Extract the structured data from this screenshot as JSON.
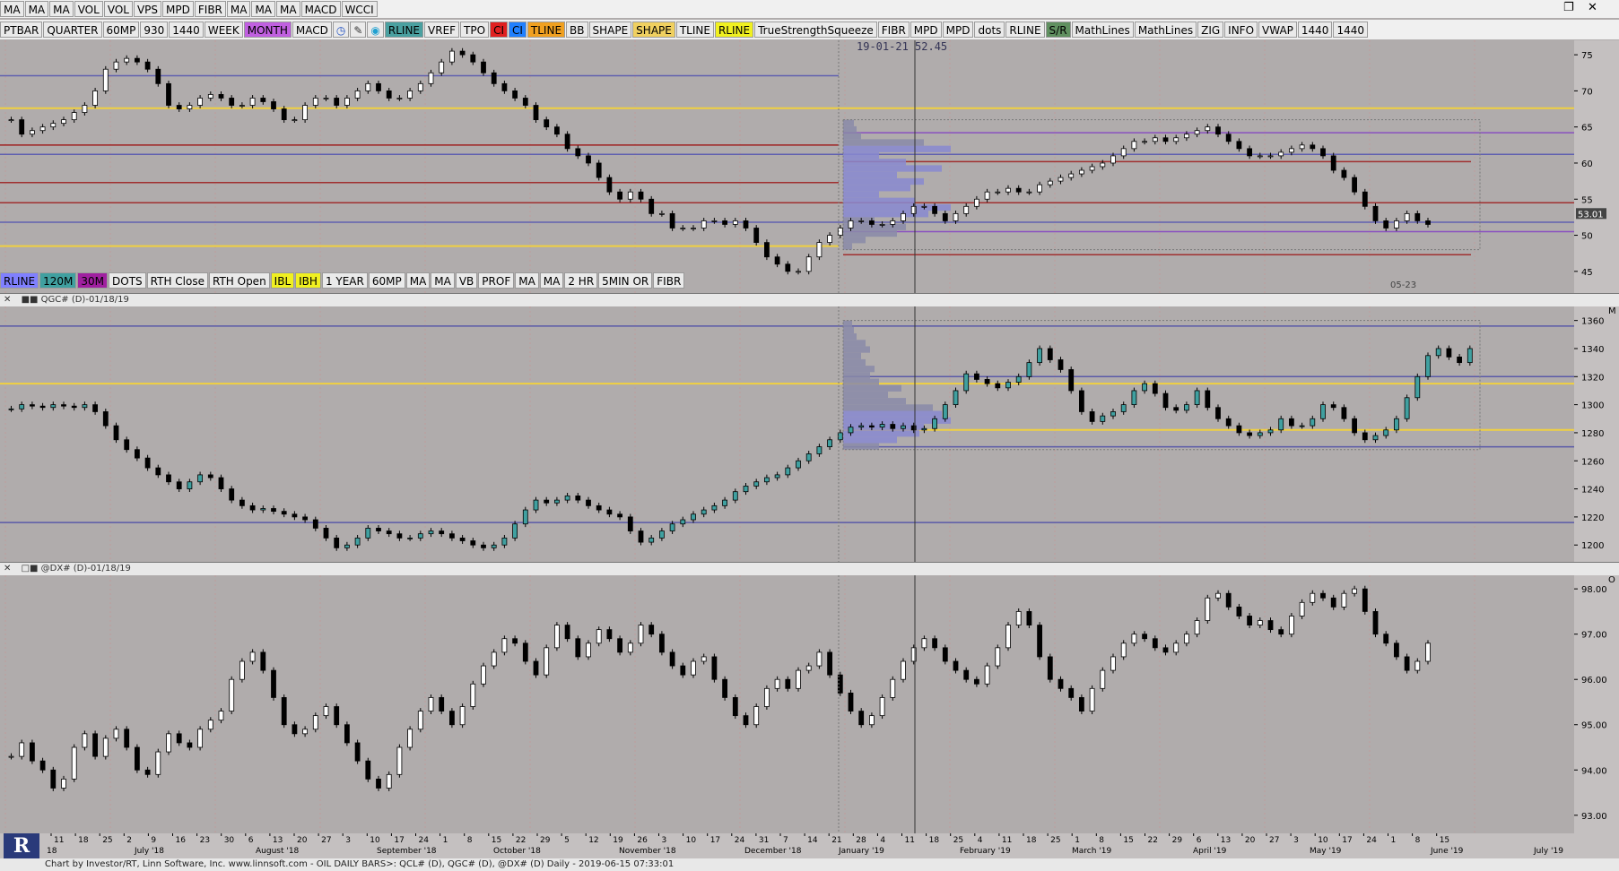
{
  "toolbar_top": [
    "MA",
    "MA",
    "MA",
    "VOL",
    "VOL",
    "VPS",
    "MPD",
    "FIBR",
    "MA",
    "MA",
    "MA",
    "MACD",
    "WCCI"
  ],
  "toolbar_main": [
    {
      "label": "PTBAR",
      "bg": "#eaeaea"
    },
    {
      "label": "QUARTER",
      "bg": "#eaeaea"
    },
    {
      "label": "60MP",
      "bg": "#eaeaea"
    },
    {
      "label": "930",
      "bg": "#eaeaea"
    },
    {
      "label": "1440",
      "bg": "#eaeaea"
    },
    {
      "label": "WEEK",
      "bg": "#eaeaea"
    },
    {
      "label": "MONTH",
      "bg": "#c060e0"
    },
    {
      "label": "MACD",
      "bg": "#eaeaea"
    },
    {
      "label": "clock-icon",
      "bg": "#eaeaea",
      "icon": true
    },
    {
      "label": "pencil-icon",
      "bg": "#eaeaea",
      "icon": true
    },
    {
      "label": "drop-icon",
      "bg": "#eaeaea",
      "icon": true
    },
    {
      "label": "RLINE",
      "bg": "#4aa0a0"
    },
    {
      "label": "VREF",
      "bg": "#eaeaea"
    },
    {
      "label": "TPO",
      "bg": "#eaeaea"
    },
    {
      "label": "CI",
      "bg": "#e02020"
    },
    {
      "label": "CI",
      "bg": "#2080ff"
    },
    {
      "label": "TLINE",
      "bg": "#f0a020"
    },
    {
      "label": "BB",
      "bg": "#eaeaea"
    },
    {
      "label": "SHAPE",
      "bg": "#eaeaea"
    },
    {
      "label": "SHAPE",
      "bg": "#f0d060"
    },
    {
      "label": "TLINE",
      "bg": "#eaeaea"
    },
    {
      "label": "RLINE",
      "bg": "#f0f020"
    },
    {
      "label": "TrueStrengthSqueeze",
      "bg": "#eaeaea"
    },
    {
      "label": "FIBR",
      "bg": "#eaeaea"
    },
    {
      "label": "MPD",
      "bg": "#eaeaea"
    },
    {
      "label": "MPD",
      "bg": "#eaeaea"
    },
    {
      "label": "dots",
      "bg": "#eaeaea"
    },
    {
      "label": "RLINE",
      "bg": "#eaeaea"
    },
    {
      "label": "S/R",
      "bg": "#609060"
    },
    {
      "label": "MathLines",
      "bg": "#eaeaea"
    },
    {
      "label": "MathLines",
      "bg": "#eaeaea"
    },
    {
      "label": "ZIG",
      "bg": "#eaeaea"
    },
    {
      "label": "INFO",
      "bg": "#eaeaea"
    },
    {
      "label": "VWAP",
      "bg": "#eaeaea"
    },
    {
      "label": "1440",
      "bg": "#eaeaea"
    },
    {
      "label": "1440",
      "bg": "#eaeaea"
    }
  ],
  "toolbar_lower": [
    {
      "label": "RLINE",
      "bg": "#8080ff"
    },
    {
      "label": "120M",
      "bg": "#40a0a0"
    },
    {
      "label": "30M",
      "bg": "#a020a0"
    },
    {
      "label": "DOTS",
      "bg": "#eaeaea"
    },
    {
      "label": "RTH Close",
      "bg": "#eaeaea"
    },
    {
      "label": "RTH Open",
      "bg": "#eaeaea"
    },
    {
      "label": "IBL",
      "bg": "#f0f020"
    },
    {
      "label": "IBH",
      "bg": "#f0f020"
    },
    {
      "label": "1 YEAR",
      "bg": "#eaeaea"
    },
    {
      "label": "60MP",
      "bg": "#eaeaea"
    },
    {
      "label": "MA",
      "bg": "#eaeaea"
    },
    {
      "label": "MA",
      "bg": "#eaeaea"
    },
    {
      "label": "VB",
      "bg": "#eaeaea"
    },
    {
      "label": "PROF",
      "bg": "#eaeaea"
    },
    {
      "label": "MA",
      "bg": "#eaeaea"
    },
    {
      "label": "MA",
      "bg": "#eaeaea"
    },
    {
      "label": "2 HR",
      "bg": "#eaeaea"
    },
    {
      "label": "5MIN OR",
      "bg": "#eaeaea"
    },
    {
      "label": "FIBR",
      "bg": "#eaeaea"
    }
  ],
  "cursor_label": "19-01-21  52.45",
  "panel2_title": "QGC# (D)-01/18/19",
  "panel3_title": "@DX# (D)-01/18/19",
  "price_marker": "53.01",
  "date_marker": "05-23",
  "axis_labels": {
    "p1": [
      "75",
      "70",
      "65",
      "60",
      "55",
      "50",
      "45"
    ],
    "p2": [
      "1360",
      "1340",
      "1320",
      "1300",
      "1280",
      "1260",
      "1240",
      "1220",
      "1200"
    ],
    "p3": [
      "98.00",
      "97.00",
      "96.00",
      "95.00",
      "94.00",
      "93.00"
    ]
  },
  "pane_letters": {
    "p2": "M",
    "p3": "O"
  },
  "x_days": [
    "11",
    "18",
    "25",
    "2",
    "9",
    "16",
    "23",
    "30",
    "6",
    "13",
    "20",
    "27",
    "3",
    "10",
    "17",
    "24",
    "1",
    "8",
    "15",
    "22",
    "29",
    "5",
    "12",
    "19",
    "26",
    "3",
    "10",
    "17",
    "24",
    "31",
    "7",
    "14",
    "21",
    "28",
    "4",
    "11",
    "18",
    "25",
    "4",
    "11",
    "18",
    "25",
    "1",
    "8",
    "15",
    "22",
    "29",
    "6",
    "13",
    "20",
    "27",
    "3",
    "10",
    "17",
    "24",
    "1",
    "8",
    "15"
  ],
  "x_months": [
    "18",
    "July '18",
    "August '18",
    "September '18",
    "October '18",
    "November '18",
    "December '18",
    "January '19",
    "February '19",
    "March '19",
    "April '19",
    "May '19",
    "June '19",
    "July '19"
  ],
  "footer": "Chart by Investor/RT, Linn Software, Inc. www.linnsoft.com - OIL DAILY BARS>: QCL# (D), QGC# (D), @DX# (D) Daily - 2019-06-15 07:33:01",
  "logo": "R",
  "chart_data": [
    {
      "type": "candlestick",
      "symbol": "QCL#",
      "ylim": [
        42,
        77
      ],
      "y_ticks": [
        75,
        70,
        65,
        60,
        55,
        50,
        45
      ],
      "current_price": 53.01,
      "closes": [
        66,
        64,
        64.5,
        65,
        65.5,
        66,
        67,
        68,
        70,
        73,
        74,
        74.5,
        74,
        73,
        71,
        68,
        67.5,
        68,
        69,
        69.5,
        69,
        68,
        68,
        69,
        68.5,
        67.5,
        66,
        66,
        68,
        69,
        69,
        68,
        69,
        70,
        71,
        70,
        69,
        69,
        70,
        71,
        72.5,
        74,
        75.5,
        75,
        74,
        72.5,
        71,
        70,
        69,
        68,
        66,
        65,
        64,
        62,
        61,
        60,
        58,
        56,
        55,
        56,
        55,
        53,
        53,
        51,
        51,
        51,
        52,
        52,
        51.5,
        52,
        51,
        49,
        47,
        46,
        45,
        45,
        47,
        49,
        50,
        51,
        52,
        52,
        51.5,
        51.5,
        52,
        53,
        54,
        54,
        53,
        52,
        53,
        54,
        55,
        56,
        56,
        56.5,
        56,
        56,
        57,
        57.5,
        58,
        58.5,
        59,
        59.5,
        60,
        61,
        62,
        63,
        63,
        63.5,
        63,
        63.5,
        64,
        64.5,
        65,
        64,
        63,
        62,
        61,
        61,
        61,
        61.5,
        62,
        62.5,
        62,
        61,
        59,
        58,
        56,
        54,
        52,
        51,
        52,
        53,
        52,
        51.5
      ]
    },
    {
      "type": "candlestick",
      "symbol": "QGC#",
      "ylim": [
        1188,
        1370
      ],
      "y_ticks": [
        1360,
        1340,
        1320,
        1300,
        1280,
        1260,
        1240,
        1220,
        1200
      ],
      "closes": [
        1297,
        1300,
        1299,
        1298,
        1300,
        1299,
        1298,
        1300,
        1295,
        1285,
        1275,
        1268,
        1262,
        1255,
        1250,
        1245,
        1240,
        1245,
        1250,
        1248,
        1240,
        1232,
        1228,
        1225,
        1226,
        1224,
        1222,
        1220,
        1218,
        1212,
        1205,
        1198,
        1200,
        1205,
        1212,
        1210,
        1208,
        1205,
        1205,
        1208,
        1210,
        1208,
        1205,
        1203,
        1200,
        1198,
        1200,
        1205,
        1215,
        1225,
        1232,
        1230,
        1232,
        1235,
        1232,
        1228,
        1225,
        1222,
        1220,
        1210,
        1202,
        1205,
        1210,
        1215,
        1218,
        1222,
        1225,
        1228,
        1232,
        1238,
        1242,
        1245,
        1248,
        1250,
        1255,
        1260,
        1265,
        1270,
        1275,
        1280,
        1284,
        1285,
        1284,
        1286,
        1283,
        1285,
        1282,
        1283,
        1290,
        1300,
        1310,
        1322,
        1318,
        1315,
        1312,
        1316,
        1320,
        1330,
        1340,
        1332,
        1325,
        1310,
        1295,
        1288,
        1292,
        1295,
        1300,
        1310,
        1315,
        1308,
        1298,
        1296,
        1300,
        1310,
        1298,
        1290,
        1285,
        1280,
        1278,
        1280,
        1282,
        1290,
        1285,
        1285,
        1290,
        1300,
        1298,
        1290,
        1280,
        1275,
        1278,
        1282,
        1290,
        1305,
        1320,
        1335,
        1340,
        1334,
        1330,
        1340
      ]
    },
    {
      "type": "candlestick",
      "symbol": "@DX#",
      "ylim": [
        92.6,
        98.3
      ],
      "y_ticks": [
        98,
        97,
        96,
        95,
        94,
        93
      ],
      "closes": [
        94.3,
        94.6,
        94.2,
        94.0,
        93.6,
        93.8,
        94.5,
        94.8,
        94.3,
        94.7,
        94.9,
        94.5,
        94.0,
        93.9,
        94.4,
        94.8,
        94.6,
        94.5,
        94.9,
        95.1,
        95.3,
        96.0,
        96.4,
        96.6,
        96.2,
        95.6,
        95.0,
        94.8,
        94.9,
        95.2,
        95.4,
        95.0,
        94.6,
        94.2,
        93.8,
        93.6,
        93.9,
        94.5,
        94.9,
        95.3,
        95.6,
        95.3,
        95.0,
        95.4,
        95.9,
        96.3,
        96.6,
        96.9,
        96.8,
        96.4,
        96.1,
        96.7,
        97.2,
        96.9,
        96.5,
        96.8,
        97.1,
        96.9,
        96.6,
        96.8,
        97.2,
        97.0,
        96.6,
        96.3,
        96.1,
        96.4,
        96.5,
        96.0,
        95.6,
        95.2,
        95.0,
        95.4,
        95.8,
        96.0,
        95.8,
        96.2,
        96.3,
        96.6,
        96.1,
        95.7,
        95.3,
        95.0,
        95.2,
        95.6,
        96.0,
        96.4,
        96.7,
        96.9,
        96.7,
        96.4,
        96.2,
        96.0,
        95.9,
        96.3,
        96.7,
        97.2,
        97.5,
        97.2,
        96.5,
        96.0,
        95.8,
        95.6,
        95.3,
        95.8,
        96.2,
        96.5,
        96.8,
        97.0,
        96.9,
        96.7,
        96.6,
        96.8,
        97.0,
        97.3,
        97.8,
        97.9,
        97.6,
        97.4,
        97.2,
        97.3,
        97.1,
        97.0,
        97.4,
        97.7,
        97.9,
        97.8,
        97.6,
        97.9,
        98.0,
        97.5,
        97.0,
        96.8,
        96.5,
        96.2,
        96.4,
        96.8
      ]
    }
  ]
}
